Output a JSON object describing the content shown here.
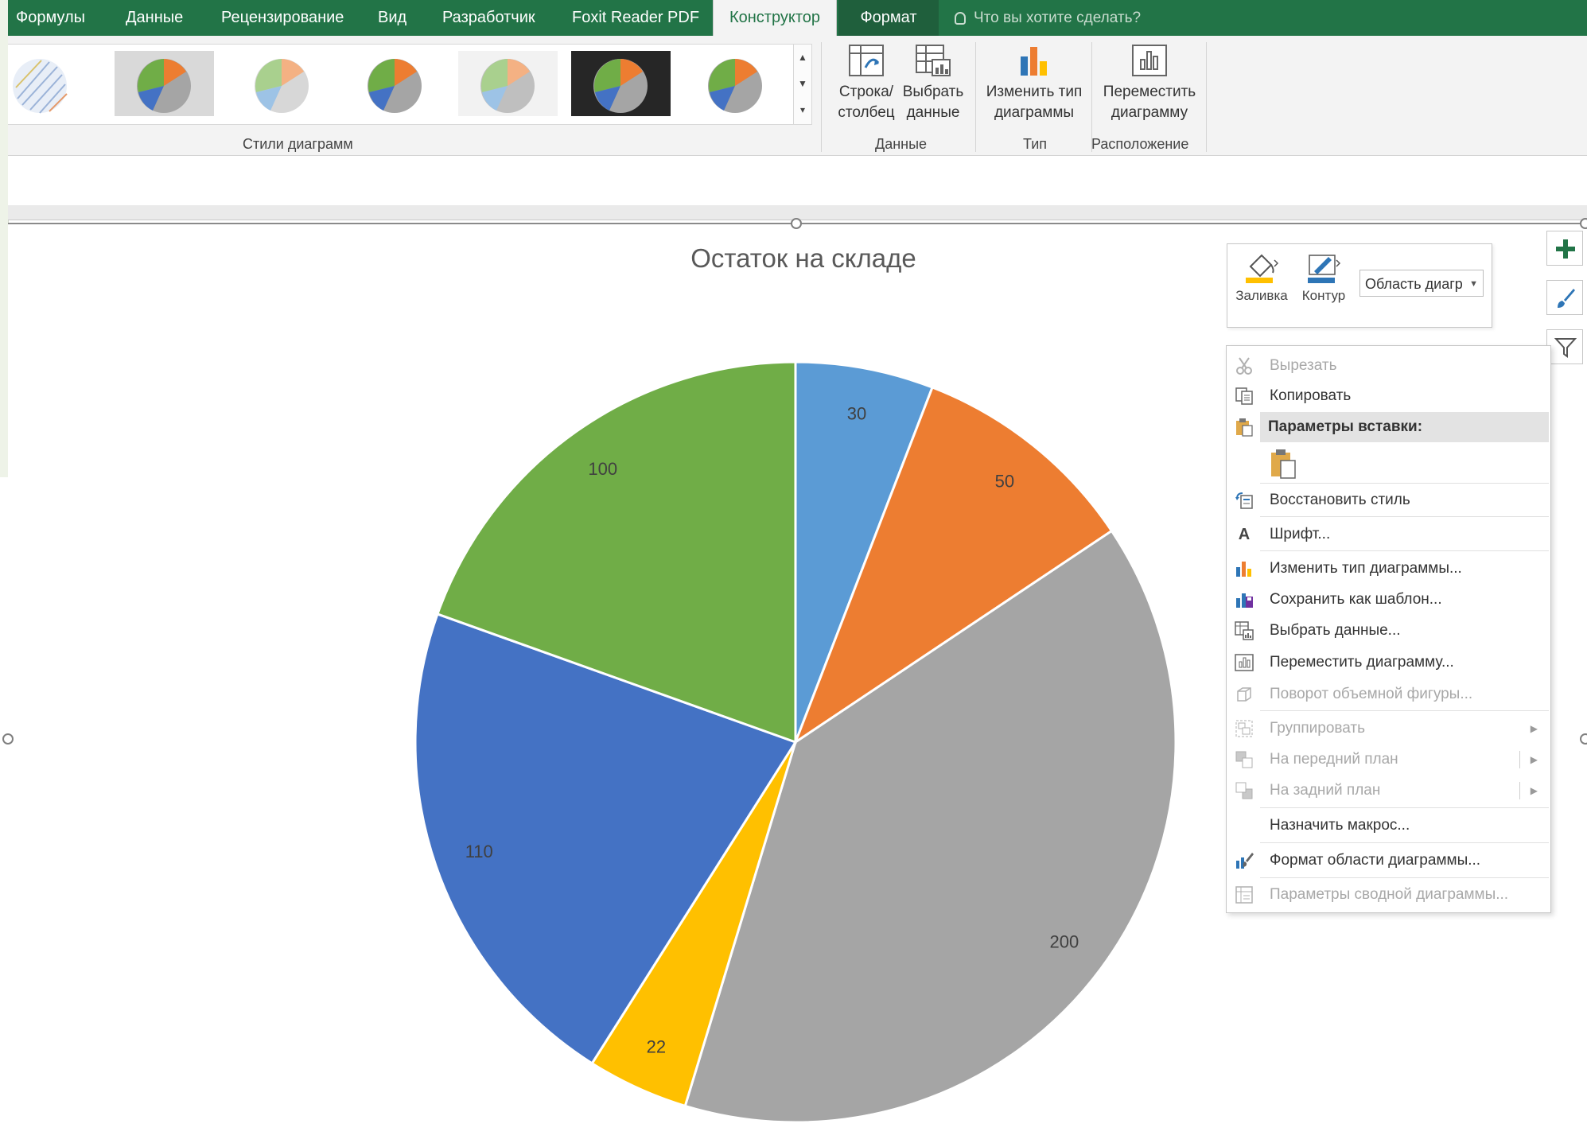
{
  "tabs": [
    {
      "label": "Формулы"
    },
    {
      "label": "Данные"
    },
    {
      "label": "Рецензирование"
    },
    {
      "label": "Вид"
    },
    {
      "label": "Разработчик"
    },
    {
      "label": "Foxit Reader PDF"
    },
    {
      "label": "Конструктор"
    },
    {
      "label": "Формат"
    }
  ],
  "active_tab": "Конструктор",
  "tell_me": "Что вы хотите сделать?",
  "ribbon": {
    "styles_group_label": "Стили диаграмм",
    "data_group_label": "Данные",
    "type_group_label": "Тип",
    "location_group_label": "Расположение",
    "switch_row_col": [
      "Строка/",
      "столбец"
    ],
    "select_data": [
      "Выбрать",
      "данные"
    ],
    "change_type": [
      "Изменить тип",
      "диаграммы"
    ],
    "move_chart": [
      "Переместить",
      "диаграмму"
    ]
  },
  "chart_data": {
    "type": "pie",
    "title": "Остаток на складе",
    "values": [
      30,
      50,
      200,
      22,
      110,
      100
    ],
    "colors": [
      "#5b9bd5",
      "#ed7d31",
      "#a5a5a5",
      "#ffc000",
      "#4472c4",
      "#70ad47"
    ],
    "data_labels": [
      "30",
      "50",
      "200",
      "22",
      "110",
      "100"
    ]
  },
  "mini_toolbar": {
    "fill_label": "Заливка",
    "outline_label": "Контур",
    "element_select": "Область диагр"
  },
  "context_menu": {
    "items": [
      {
        "label": "Вырезать",
        "icon": "scissors-icon",
        "disabled": true
      },
      {
        "label": "Копировать",
        "icon": "copy-icon",
        "disabled": false
      },
      {
        "label": "Параметры вставки:",
        "icon": "paste-icon",
        "header": true
      },
      {
        "label": "Восстановить стиль",
        "icon": "reset-style-icon",
        "disabled": false
      },
      {
        "label": "Шрифт...",
        "icon": "font-icon",
        "disabled": false
      },
      {
        "label": "Изменить тип диаграммы...",
        "icon": "change-chart-type-icon",
        "disabled": false
      },
      {
        "label": "Сохранить как шаблон...",
        "icon": "save-template-icon",
        "disabled": false
      },
      {
        "label": "Выбрать данные...",
        "icon": "select-data-icon",
        "disabled": false
      },
      {
        "label": "Переместить диаграмму...",
        "icon": "move-chart-icon",
        "disabled": false
      },
      {
        "label": "Поворот объемной фигуры...",
        "icon": "3d-rotation-icon",
        "disabled": true
      },
      {
        "label": "Группировать",
        "icon": "group-icon",
        "disabled": true,
        "submenu": true
      },
      {
        "label": "На передний план",
        "icon": "bring-forward-icon",
        "disabled": true,
        "submenu": true
      },
      {
        "label": "На задний план",
        "icon": "send-backward-icon",
        "disabled": true,
        "submenu": true
      },
      {
        "label": "Назначить макрос...",
        "icon": "",
        "disabled": false
      },
      {
        "label": "Формат области диаграммы...",
        "icon": "format-chart-area-icon",
        "disabled": false
      },
      {
        "label": "Параметры сводной диаграммы...",
        "icon": "pivot-chart-options-icon",
        "disabled": true
      }
    ]
  },
  "colors": {
    "excel_green": "#227447",
    "ribbon_bg": "#f3f3f3"
  }
}
